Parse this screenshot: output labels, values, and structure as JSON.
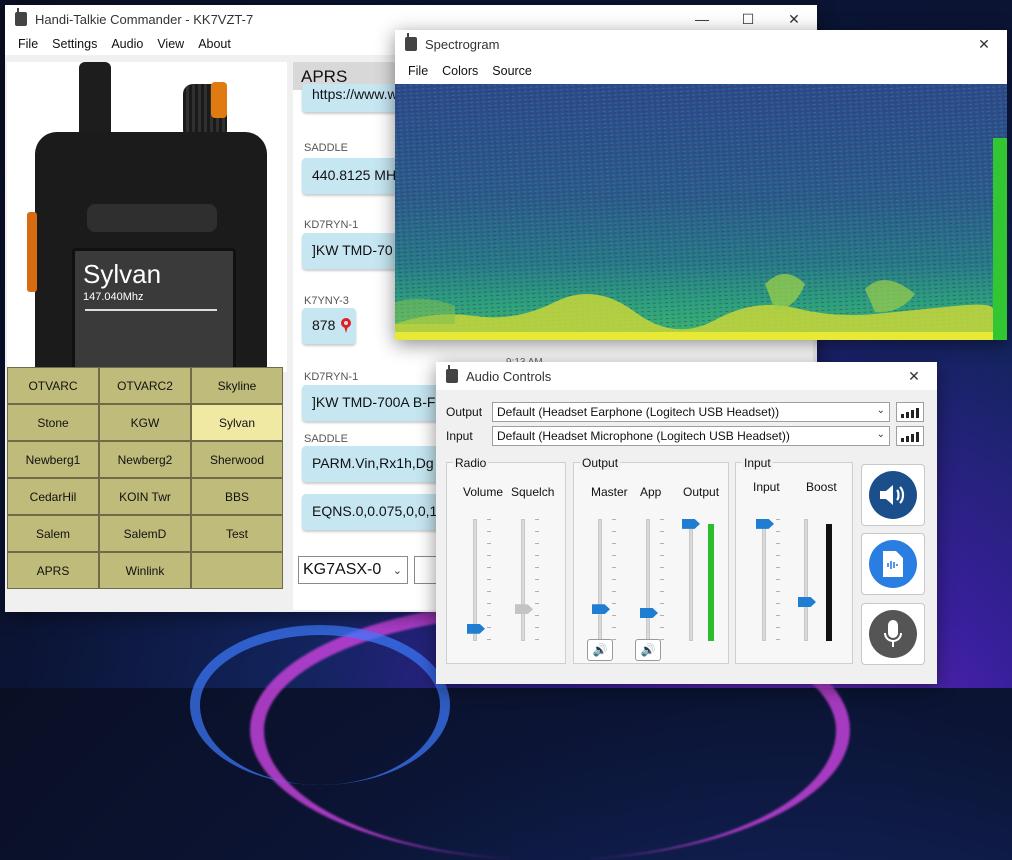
{
  "main_window": {
    "title": "Handi-Talkie Commander - KK7VZT-7",
    "menu": [
      "File",
      "Settings",
      "Audio",
      "View",
      "About"
    ],
    "radio_display": {
      "channel_name": "Sylvan",
      "frequency": "147.040Mhz"
    },
    "channels": [
      {
        "label": "OTVARC",
        "selected": false
      },
      {
        "label": "OTVARC2",
        "selected": false
      },
      {
        "label": "Skyline",
        "selected": false
      },
      {
        "label": "Stone",
        "selected": false
      },
      {
        "label": "KGW",
        "selected": false
      },
      {
        "label": "Sylvan",
        "selected": true
      },
      {
        "label": "Newberg1",
        "selected": false
      },
      {
        "label": "Newberg2",
        "selected": false
      },
      {
        "label": "Sherwood",
        "selected": false
      },
      {
        "label": "CedarHil",
        "selected": false
      },
      {
        "label": "KOIN Twr",
        "selected": false
      },
      {
        "label": "BBS",
        "selected": false
      },
      {
        "label": "Salem",
        "selected": false
      },
      {
        "label": "SalemD",
        "selected": false
      },
      {
        "label": "Test",
        "selected": false
      },
      {
        "label": "APRS",
        "selected": false
      },
      {
        "label": "Winlink",
        "selected": false
      },
      {
        "label": "",
        "selected": false
      }
    ],
    "aprs": {
      "header": "APRS",
      "messages": [
        {
          "sender": "",
          "text": "https://www.w"
        },
        {
          "sender": "SADDLE",
          "text": "440.8125 MH"
        },
        {
          "sender": "KD7RYN-1",
          "text": "]KW TMD-70"
        },
        {
          "sender": "K7YNY-3",
          "text": "878"
        },
        {
          "sender": "KD7RYN-1",
          "text": "]KW TMD-700A  B-F"
        },
        {
          "sender": "SADDLE",
          "text": "PARM.Vin,Rx1h,Dg"
        },
        {
          "sender": "",
          "text": "EQNS.0,0.075,0,0,1"
        }
      ],
      "timestamp": "9:13 AM",
      "callsign": "KG7ASX-0"
    }
  },
  "spectrogram_window": {
    "title": "Spectrogram",
    "menu": [
      "File",
      "Colors",
      "Source"
    ]
  },
  "audio_window": {
    "title": "Audio Controls",
    "output_label": "Output",
    "output_device": "Default (Headset Earphone (Logitech USB Headset))",
    "input_label": "Input",
    "input_device": "Default (Headset Microphone (Logitech USB Headset))",
    "radio_group": {
      "title": "Radio",
      "volume_label": "Volume",
      "squelch_label": "Squelch",
      "volume": 0.1,
      "squelch": 0.26,
      "squelch_enabled": false
    },
    "output_group": {
      "title": "Output",
      "master_label": "Master",
      "app_label": "App",
      "output_label": "Output",
      "master": 0.26,
      "app": 0.23,
      "output": 0.96,
      "output_meter": 0.96
    },
    "input_group": {
      "title": "Input",
      "input_label": "Input",
      "boost_label": "Boost",
      "input": 0.96,
      "boost": 0.32,
      "input_meter": 0.96
    },
    "big_buttons": [
      "speaker-icon",
      "audio-file-icon",
      "microphone-icon"
    ],
    "colors": {
      "accent": "#1f7ed1",
      "meter_green": "#2bbd2b",
      "speaker_button": "#1b4f8c",
      "file_button": "#2a7de1",
      "mic_button": "#555555"
    }
  }
}
